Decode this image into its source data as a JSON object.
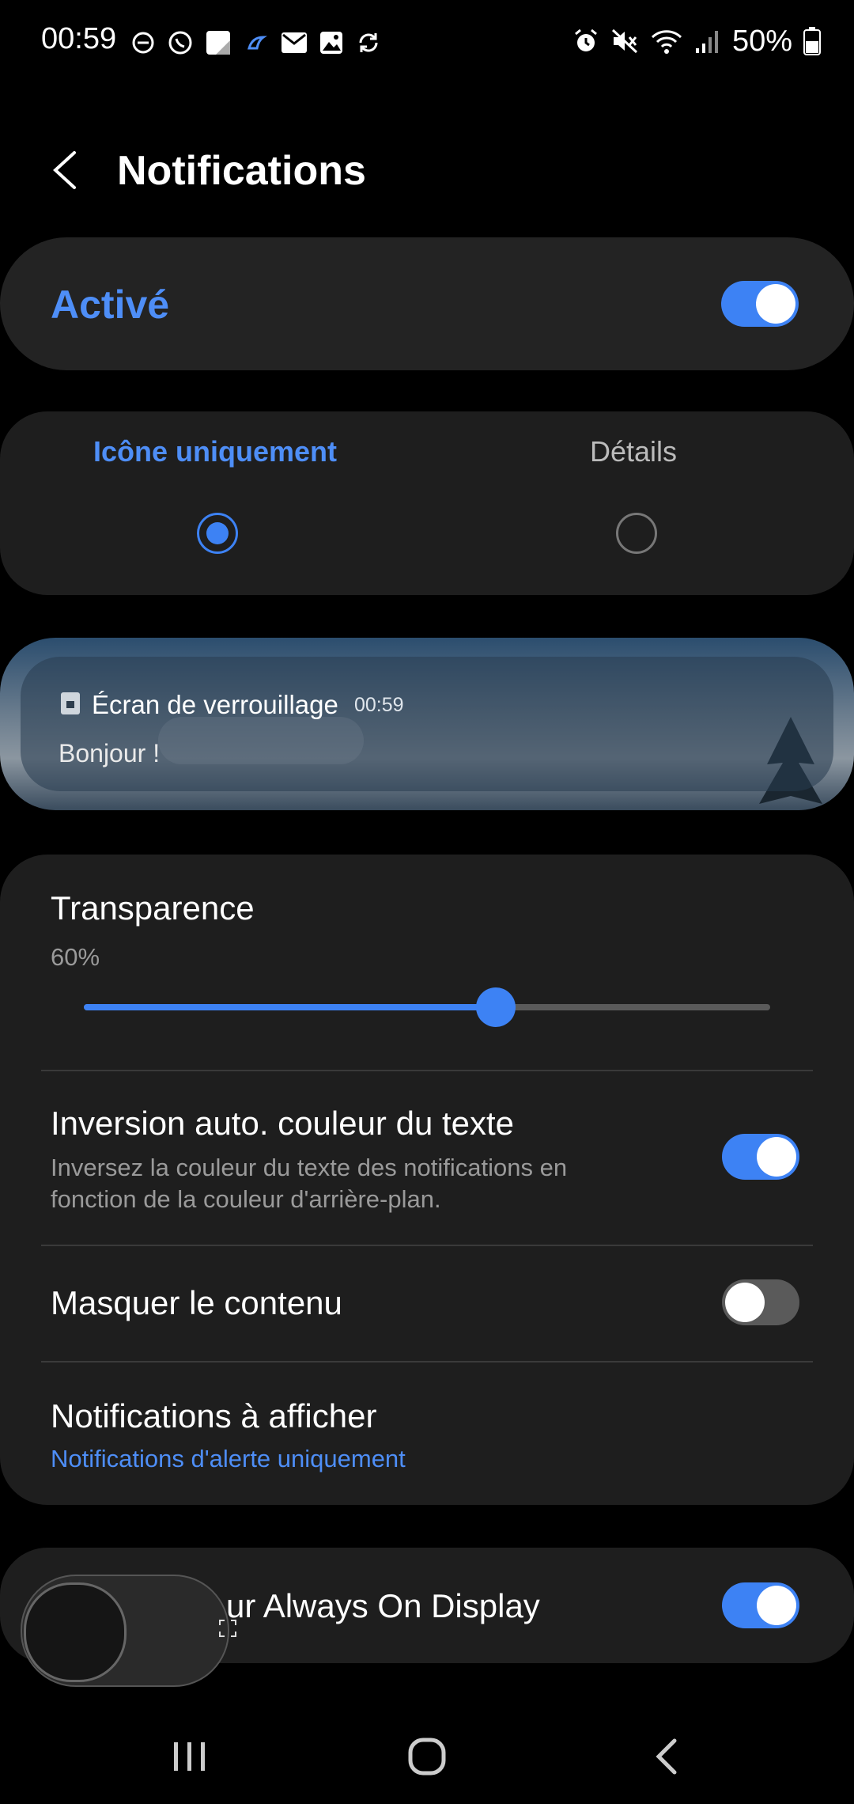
{
  "status_bar": {
    "time": "00:59",
    "left_icons": [
      "do-not-disturb-icon",
      "whatsapp-icon",
      "note-icon",
      "app-icon",
      "mail-icon",
      "gallery-icon",
      "sync-icon"
    ],
    "right_icons": [
      "alarm-icon",
      "mute-icon",
      "wifi-icon",
      "signal-icon"
    ],
    "battery": "50%"
  },
  "header": {
    "title": "Notifications"
  },
  "master": {
    "label": "Activé",
    "on": true
  },
  "style": {
    "options": [
      "Icône uniquement",
      "Détails"
    ],
    "selected": 0
  },
  "preview": {
    "app": "Écran de verrouillage",
    "time": "00:59",
    "text": "Bonjour !"
  },
  "transparency": {
    "label": "Transparence",
    "value_text": "60%",
    "value": 0.6
  },
  "invert": {
    "title": "Inversion auto. couleur du texte",
    "subtitle_line1": "Inversez la couleur du texte des notifications en",
    "subtitle_line2": "fonction de la couleur d'arrière-plan.",
    "on": true
  },
  "hide": {
    "title": "Masquer le contenu",
    "on": false
  },
  "show": {
    "title": "Notifications à afficher",
    "value": "Notifications d'alerte uniquement"
  },
  "aod": {
    "title_visible": "ur Always On Display",
    "on": true
  },
  "colors": {
    "accent": "#3d82f4",
    "link": "#4e8ef7",
    "card": "#1e1e1e"
  }
}
